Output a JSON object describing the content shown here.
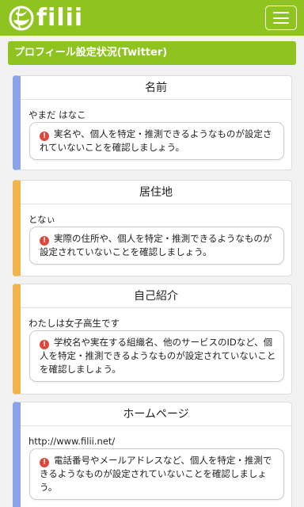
{
  "header": {
    "logo_text": "filii",
    "brand_color": "#8fc31f"
  },
  "section": {
    "title": "プロフィール設定状況(Twitter)"
  },
  "cards": [
    {
      "title": "名前",
      "value": "やまだ はなこ",
      "warning": "実名や、個人を特定・推測できるようなものが設定されていないことを確認しましょう。",
      "accent": "#8aa4e8"
    },
    {
      "title": "居住地",
      "value": "となぃ",
      "warning": "実際の住所や、個人を特定・推測できるようなものが設定されていないことを確認しましょう。",
      "accent": "#f0b44c"
    },
    {
      "title": "自己紹介",
      "value": "わたしは女子高生です",
      "warning": "学校名や実在する組織名、他のサービスのIDなど、個人を特定・推測できるようなものが設定されていないことを確認しましょう。",
      "accent": "#f0b44c"
    },
    {
      "title": "ホームページ",
      "value": "http://www.filii.net/",
      "warning": "電話番号やメールアドレスなど、個人を特定・推測できるようなものが設定されていないことを確認しましょう。",
      "accent": "#8aa4e8"
    }
  ]
}
